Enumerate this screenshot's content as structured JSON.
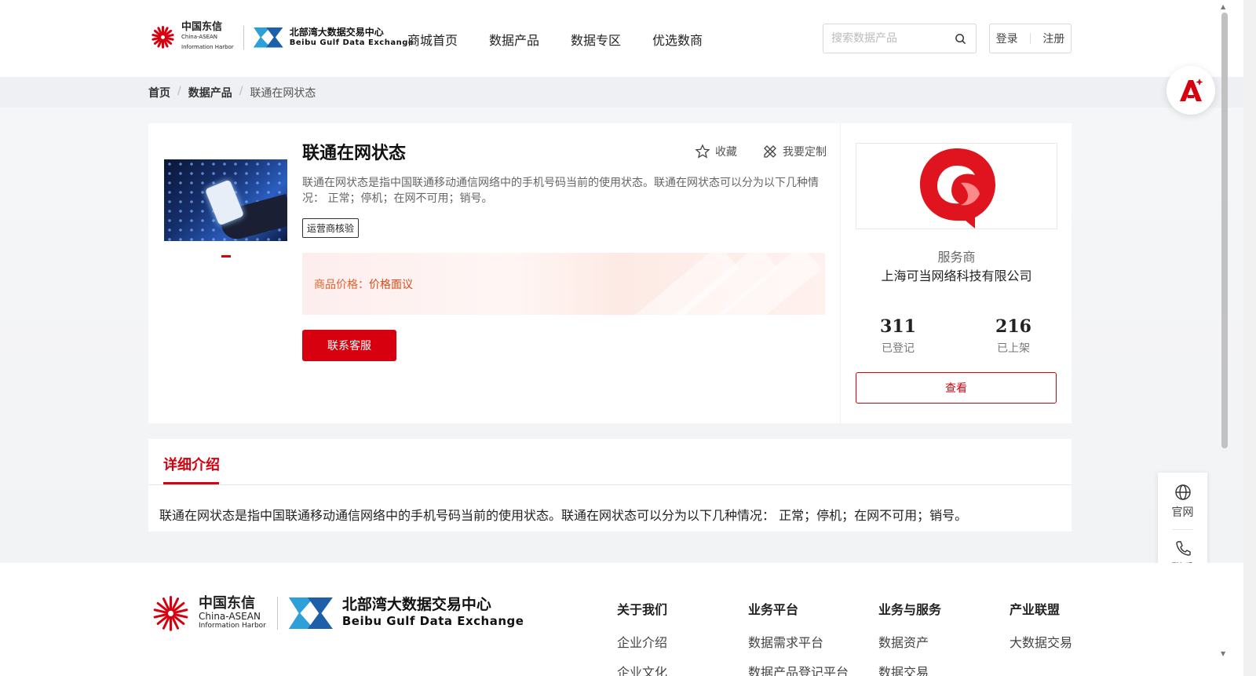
{
  "header": {
    "brand_cn1": "中国东信",
    "brand_en1a": "China-ASEAN",
    "brand_en1b": "Information Harbor",
    "brand_cn2": "北部湾大数据交易中心",
    "brand_en2": "Beibu Gulf Data Exchange",
    "nav": [
      "商城首页",
      "数据产品",
      "数据专区",
      "优选数商"
    ],
    "search_placeholder": "搜索数据产品",
    "login": "登录",
    "register": "注册"
  },
  "breadcrumb": [
    "首页",
    "数据产品",
    "联通在网状态"
  ],
  "product": {
    "title": "联通在网状态",
    "favorite": "收藏",
    "customize": "我要定制",
    "description": "联通在网状态是指中国联通移动通信网络中的手机号码当前的使用状态。联通在网状态可以分为以下几种情况： 正常；停机；在网不可用；销号。",
    "tag": "运营商核验",
    "price_label": "商品价格：",
    "price_value": "价格面议",
    "contact_button": "联系客服"
  },
  "provider": {
    "type_label": "服务商",
    "name": "上海可当网络科技有限公司",
    "registered_count": "311",
    "registered_label": "已登记",
    "listed_count": "216",
    "listed_label": "已上架",
    "view_button": "查看"
  },
  "detail": {
    "tab": "详细介绍",
    "text": "联通在网状态是指中国联通移动通信网络中的手机号码当前的使用状态。联通在网状态可以分为以下几种情况： 正常；停机；在网不可用；销号。"
  },
  "side": {
    "website": "官网",
    "contact": "联系"
  },
  "footer": {
    "columns": [
      {
        "heading": "关于我们",
        "item1": "企业介绍",
        "item2": "企业文化"
      },
      {
        "heading": "业务平台",
        "item1": "数据需求平台",
        "item2": "数据产品登记平台"
      },
      {
        "heading": "业务与服务",
        "item1": "数据资产",
        "item2": "数据交易"
      },
      {
        "heading": "产业联盟",
        "item1": "大数据交易"
      }
    ]
  },
  "colors": {
    "accent": "#d7000f",
    "price": "#e3602c"
  }
}
